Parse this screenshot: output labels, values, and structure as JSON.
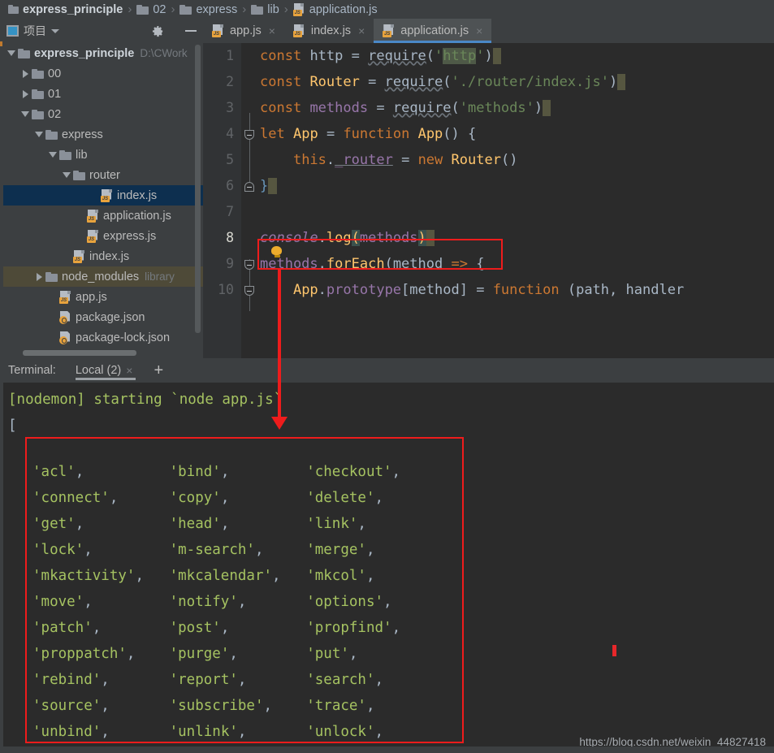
{
  "breadcrumb": {
    "items": [
      {
        "label": "express_principle",
        "icon": "folder-icon"
      },
      {
        "label": "02",
        "icon": "folder-icon"
      },
      {
        "label": "express",
        "icon": "folder-icon"
      },
      {
        "label": "lib",
        "icon": "folder-icon"
      },
      {
        "label": "application.js",
        "icon": "js-file-icon"
      }
    ],
    "separator": "›"
  },
  "project_panel": {
    "title": "项目",
    "project_icon": "project-icon",
    "dropdown_icon": "chevron-down-icon",
    "settings_icon": "gear-icon",
    "minimize_icon": "minimize-icon",
    "tree": [
      {
        "label": "express_principle",
        "sub": "D:\\CWork",
        "indent": 0,
        "twisty": "down",
        "icon": "folder-icon",
        "state": "root"
      },
      {
        "label": "00",
        "sub": "",
        "indent": 1,
        "twisty": "right",
        "icon": "folder-icon",
        "state": "normal"
      },
      {
        "label": "01",
        "sub": "",
        "indent": 1,
        "twisty": "right",
        "icon": "folder-icon",
        "state": "normal"
      },
      {
        "label": "02",
        "sub": "",
        "indent": 1,
        "twisty": "down",
        "icon": "folder-icon",
        "state": "normal"
      },
      {
        "label": "express",
        "sub": "",
        "indent": 2,
        "twisty": "down",
        "icon": "folder-icon",
        "state": "normal"
      },
      {
        "label": "lib",
        "sub": "",
        "indent": 3,
        "twisty": "down",
        "icon": "folder-icon",
        "state": "normal"
      },
      {
        "label": "router",
        "sub": "",
        "indent": 4,
        "twisty": "down",
        "icon": "folder-icon",
        "state": "normal"
      },
      {
        "label": "index.js",
        "sub": "",
        "indent": 6,
        "twisty": "none",
        "icon": "js-file-icon",
        "state": "selected"
      },
      {
        "label": "application.js",
        "sub": "",
        "indent": 5,
        "twisty": "none",
        "icon": "js-file-icon",
        "state": "normal"
      },
      {
        "label": "express.js",
        "sub": "",
        "indent": 5,
        "twisty": "none",
        "icon": "js-file-icon",
        "state": "normal"
      },
      {
        "label": "index.js",
        "sub": "",
        "indent": 4,
        "twisty": "none",
        "icon": "js-file-icon",
        "state": "normal"
      },
      {
        "label": "node_modules",
        "sub": "library",
        "indent": 2,
        "twisty": "right",
        "icon": "folder-icon",
        "state": "highlight"
      },
      {
        "label": "app.js",
        "sub": "",
        "indent": 3,
        "twisty": "none",
        "icon": "js-file-icon",
        "state": "normal"
      },
      {
        "label": "package.json",
        "sub": "",
        "indent": 3,
        "twisty": "none",
        "icon": "json-file-icon",
        "state": "normal"
      },
      {
        "label": "package-lock.json",
        "sub": "",
        "indent": 3,
        "twisty": "none",
        "icon": "json-file-icon",
        "state": "normal"
      }
    ]
  },
  "editor": {
    "tabs": [
      {
        "label": "app.js",
        "icon": "js-file-icon",
        "close": "×",
        "active": false
      },
      {
        "label": "index.js",
        "icon": "js-file-icon",
        "close": "×",
        "active": false
      },
      {
        "label": "application.js",
        "icon": "js-file-icon",
        "close": "×",
        "active": true
      }
    ],
    "gutter_numbers": [
      "1",
      "2",
      "3",
      "4",
      "5",
      "6",
      "7",
      "8",
      "9",
      "10"
    ],
    "current_line": "8",
    "lines": [
      "const http = require('http')",
      "const Router = require('./router/index.js')",
      "const methods = require('methods')",
      "let App = function App() {",
      "    this._router = new Router()",
      "}",
      "",
      "console.log(methods)",
      "methods.forEach(method => {",
      "    App.prototype[method] = function (path, handler"
    ]
  },
  "terminal": {
    "label": "Terminal:",
    "tab": {
      "label": "Local (2)",
      "close": "×"
    },
    "add_icon": "plus-icon",
    "header_lines": [
      "[nodemon] starting `node app.js`",
      "["
    ],
    "methods_rows": [
      [
        "'acl',",
        "'bind',",
        "'checkout',"
      ],
      [
        "'connect',",
        "'copy',",
        "'delete',"
      ],
      [
        "'get',",
        "'head',",
        "'link',"
      ],
      [
        "'lock',",
        "'m-search',",
        "'merge',"
      ],
      [
        "'mkactivity',",
        "'mkcalendar',",
        "'mkcol',"
      ],
      [
        "'move',",
        "'notify',",
        "'options',"
      ],
      [
        "'patch',",
        "'post',",
        "'propfind',"
      ],
      [
        "'proppatch',",
        "'purge',",
        "'put',"
      ],
      [
        "'rebind',",
        "'report',",
        "'search',"
      ],
      [
        "'source',",
        "'subscribe',",
        "'trace',"
      ],
      [
        "'unbind',",
        "'unlink',",
        "'unlock',"
      ]
    ]
  },
  "watermark": "https://blog.csdn.net/weixin_44827418",
  "colors": {
    "annotation_red": "#ee1c1c",
    "keyword_orange": "#cc7832",
    "string_green": "#6a8759",
    "function_yellow": "#ffc66d",
    "property_purple": "#9876aa",
    "terminal_green": "#a5c261",
    "tab_accent_blue": "#4a88c7",
    "selection_blue": "#0d2f4f"
  }
}
